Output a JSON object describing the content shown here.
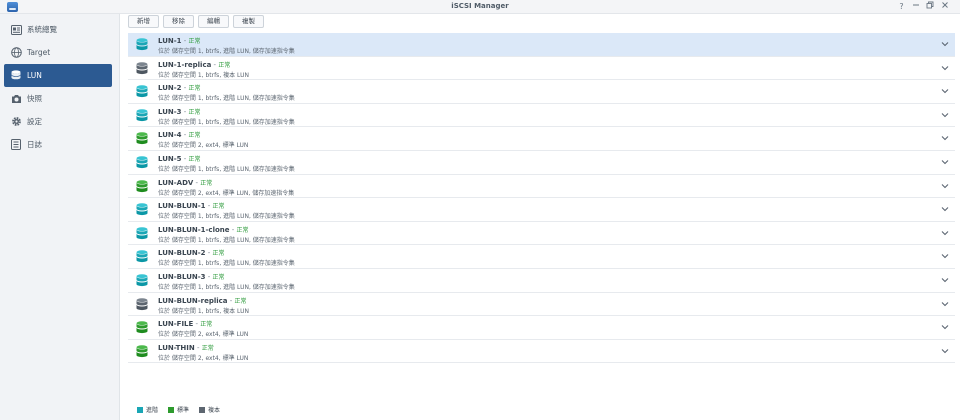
{
  "window": {
    "title": "iSCSI Manager",
    "help_icon": "?"
  },
  "sidebar": {
    "items": [
      {
        "label": "系統總覽",
        "icon": "overview-icon",
        "active": false
      },
      {
        "label": "Target",
        "icon": "globe-icon",
        "active": false
      },
      {
        "label": "LUN",
        "icon": "database-icon",
        "active": true
      },
      {
        "label": "快照",
        "icon": "camera-icon",
        "active": false
      },
      {
        "label": "設定",
        "icon": "gear-icon",
        "active": false
      },
      {
        "label": "日誌",
        "icon": "log-icon",
        "active": false
      }
    ]
  },
  "toolbar": {
    "create_label": "新增",
    "remove_label": "移除",
    "edit_label": "編輯",
    "clone_label": "複製"
  },
  "luns": [
    {
      "name": "LUN-1",
      "status": "正常",
      "desc": "位於 儲存空間 1, btrfs, 進階 LUN, 儲存加速指令集",
      "type": "advanced"
    },
    {
      "name": "LUN-1-replica",
      "status": "正常",
      "desc": "位於 儲存空間 1, btrfs, 複本 LUN",
      "type": "replica"
    },
    {
      "name": "LUN-2",
      "status": "正常",
      "desc": "位於 儲存空間 1, btrfs, 進階 LUN, 儲存加速指令集",
      "type": "advanced"
    },
    {
      "name": "LUN-3",
      "status": "正常",
      "desc": "位於 儲存空間 1, btrfs, 進階 LUN, 儲存加速指令集",
      "type": "advanced"
    },
    {
      "name": "LUN-4",
      "status": "正常",
      "desc": "位於 儲存空間 2, ext4, 標準 LUN",
      "type": "standard"
    },
    {
      "name": "LUN-5",
      "status": "正常",
      "desc": "位於 儲存空間 1, btrfs, 進階 LUN, 儲存加速指令集",
      "type": "advanced"
    },
    {
      "name": "LUN-ADV",
      "status": "正常",
      "desc": "位於 儲存空間 2, ext4, 標準 LUN, 儲存加速指令集",
      "type": "standard"
    },
    {
      "name": "LUN-BLUN-1",
      "status": "正常",
      "desc": "位於 儲存空間 1, btrfs, 進階 LUN, 儲存加速指令集",
      "type": "advanced"
    },
    {
      "name": "LUN-BLUN-1-clone",
      "status": "正常",
      "desc": "位於 儲存空間 1, btrfs, 進階 LUN, 儲存加速指令集",
      "type": "advanced"
    },
    {
      "name": "LUN-BLUN-2",
      "status": "正常",
      "desc": "位於 儲存空間 1, btrfs, 進階 LUN, 儲存加速指令集",
      "type": "advanced"
    },
    {
      "name": "LUN-BLUN-3",
      "status": "正常",
      "desc": "位於 儲存空間 1, btrfs, 進階 LUN, 儲存加速指令集",
      "type": "advanced"
    },
    {
      "name": "LUN-BLUN-replica",
      "status": "正常",
      "desc": "位於 儲存空間 1, btrfs, 複本 LUN",
      "type": "replica"
    },
    {
      "name": "LUN-FILE",
      "status": "正常",
      "desc": "位於 儲存空間 2, ext4, 標準 LUN",
      "type": "standard"
    },
    {
      "name": "LUN-THIN",
      "status": "正常",
      "desc": "位於 儲存空間 2, ext4, 標準 LUN",
      "type": "standard"
    }
  ],
  "legend": [
    {
      "label": "進階",
      "type": "advanced"
    },
    {
      "label": "標準",
      "type": "standard"
    },
    {
      "label": "複本",
      "type": "replica"
    }
  ],
  "colors": {
    "advanced": "#1aa6b5",
    "standard": "#2e9b2e",
    "replica": "#5d6670",
    "status_ok": "#2b9a3a",
    "accent": "#2c5a92"
  }
}
